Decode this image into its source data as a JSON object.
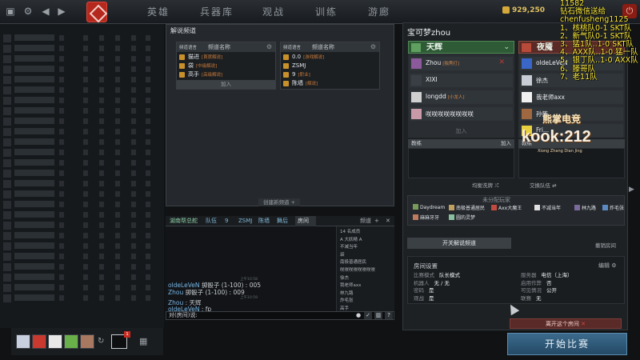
{
  "topbar": {
    "tabs": [
      "英雄",
      "兵器库",
      "观战",
      "训练",
      "游廊"
    ],
    "gold": "929,250"
  },
  "overlay": {
    "lines": [
      "11582",
      "钻石微信送给",
      "chenfusheng1125",
      "1、核桃队0-1 SKT队",
      "2、新气队0-1 SKT队",
      "3、猛1队..1-0 SKT队",
      "4、AXX队..1-0 猛一队",
      "5、银丁队..1-0 AXX队",
      "6、滕哥队",
      "7、老11队"
    ]
  },
  "commentary": {
    "title": "解说频道",
    "col_header_small": "频道语言",
    "col_header": "频道名称",
    "left_items": [
      {
        "name": "猫进",
        "tag": "[首席解说]"
      },
      {
        "name": "袋",
        "tag": "[中级解说]"
      },
      {
        "name": "高手",
        "tag": "[高级解说]"
      }
    ],
    "right_items": [
      {
        "name": "0.0",
        "tag": "[游戏解说]"
      },
      {
        "name": "ZSMJ",
        "tag": ""
      },
      {
        "name": "9",
        "tag": "[职业]"
      },
      {
        "name": "陈墙",
        "tag": "[解说]"
      }
    ],
    "join": "加入",
    "new_channel": "创建新频道 +"
  },
  "chat": {
    "tabs": [
      "湖南帮总舵",
      "队伍",
      "9",
      "ZSMJ",
      "陈墙",
      "舞后",
      "房间"
    ],
    "channels_label": "频道",
    "list": [
      "14 名成员",
      "A 大妖精 A",
      "不减当年",
      "袋",
      "南极普通居民",
      "咲咲咲咲咲咲咲咲",
      "徐杰",
      "我老师axx",
      "林九路",
      "炸毛张",
      "高手"
    ],
    "lines": [
      {
        "time": "上午10:58",
        "who": "oldeLeVeN",
        "text": "掷骰子 (1-100) : 005"
      },
      {
        "time": "",
        "who": "Zhou",
        "text": "掷骰子 (1-100) : 009"
      },
      {
        "time": "上午10:59",
        "who": "Zhou",
        "text": ": 天辉"
      },
      {
        "time": "",
        "who": "oldeLeVeN",
        "text": ": fp"
      }
    ],
    "input_prefix": "对(房间)说:"
  },
  "lobby": {
    "title": "宝可梦zhou",
    "radiant": "天辉",
    "dire": "夜魇",
    "radiant_players": [
      {
        "name": "Zhou",
        "tag": "[独秀打]"
      },
      {
        "name": "XIXI",
        "tag": ""
      },
      {
        "name": "longdd",
        "tag": "[小龙人]"
      },
      {
        "name": "咲咲咲咲咲咲咲咲",
        "tag": ""
      }
    ],
    "dire_players": [
      {
        "name": "oldeLeVeN",
        "tag": ""
      },
      {
        "name": "徐杰",
        "tag": ""
      },
      {
        "name": "我老师axx",
        "tag": ""
      },
      {
        "name": "孙策",
        "tag": ""
      },
      {
        "name": "Fri...",
        "tag": ""
      }
    ],
    "join": "加入",
    "coach": "教练",
    "coach_join": "加入",
    "balance": "均衡洗牌",
    "swap": "交换队伍",
    "unassigned_title": "未分配玩家",
    "unassigned": [
      "Daydream",
      "南极普通居民",
      "Axx大魔王",
      "不减当年",
      "林九路",
      "炸毛张",
      "麻麻牙牙",
      "圆的灵梦"
    ],
    "toggle_cc": "开关解说频道",
    "cancel_wait": "撤销房间",
    "settings_title": "房间设置",
    "edit": "编辑",
    "settings_left": [
      {
        "k": "比赛模式",
        "v": "队长模式"
      },
      {
        "k": "机器人",
        "v": "无 / 无"
      },
      {
        "k": "密码",
        "v": "是"
      },
      {
        "k": "观战",
        "v": "是"
      }
    ],
    "settings_right": [
      {
        "k": "服务器",
        "v": "电信（上海）"
      },
      {
        "k": "启用作弊",
        "v": "否"
      },
      {
        "k": "可见情况",
        "v": "公开"
      },
      {
        "k": "联赛",
        "v": "无"
      }
    ],
    "leave": "离开这个房间",
    "start": "开始比赛"
  },
  "logo": {
    "cn": "熊掌电竞",
    "en": "kook:212",
    "sub": "Xiong Zhang Dian Jing"
  },
  "party": {
    "badge": "1"
  }
}
